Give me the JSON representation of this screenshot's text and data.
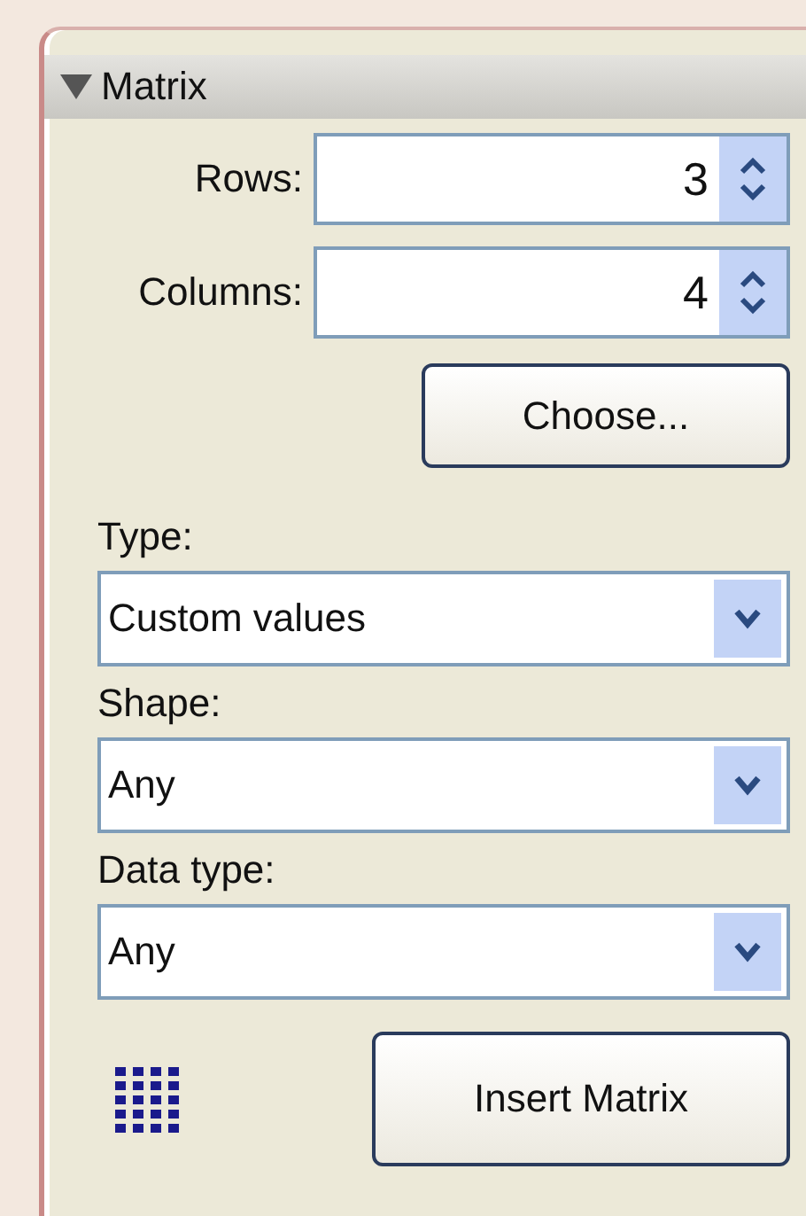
{
  "panel": {
    "title": "Matrix",
    "expanded": true
  },
  "spinners": [
    {
      "label": "Rows:",
      "value": "3"
    },
    {
      "label": "Columns:",
      "value": "4"
    }
  ],
  "choose_button": "Choose...",
  "dropdowns": [
    {
      "label": "Type:",
      "value": "Custom values"
    },
    {
      "label": "Shape:",
      "value": "Any"
    },
    {
      "label": "Data type:",
      "value": "Any"
    }
  ],
  "insert_button": "Insert Matrix"
}
